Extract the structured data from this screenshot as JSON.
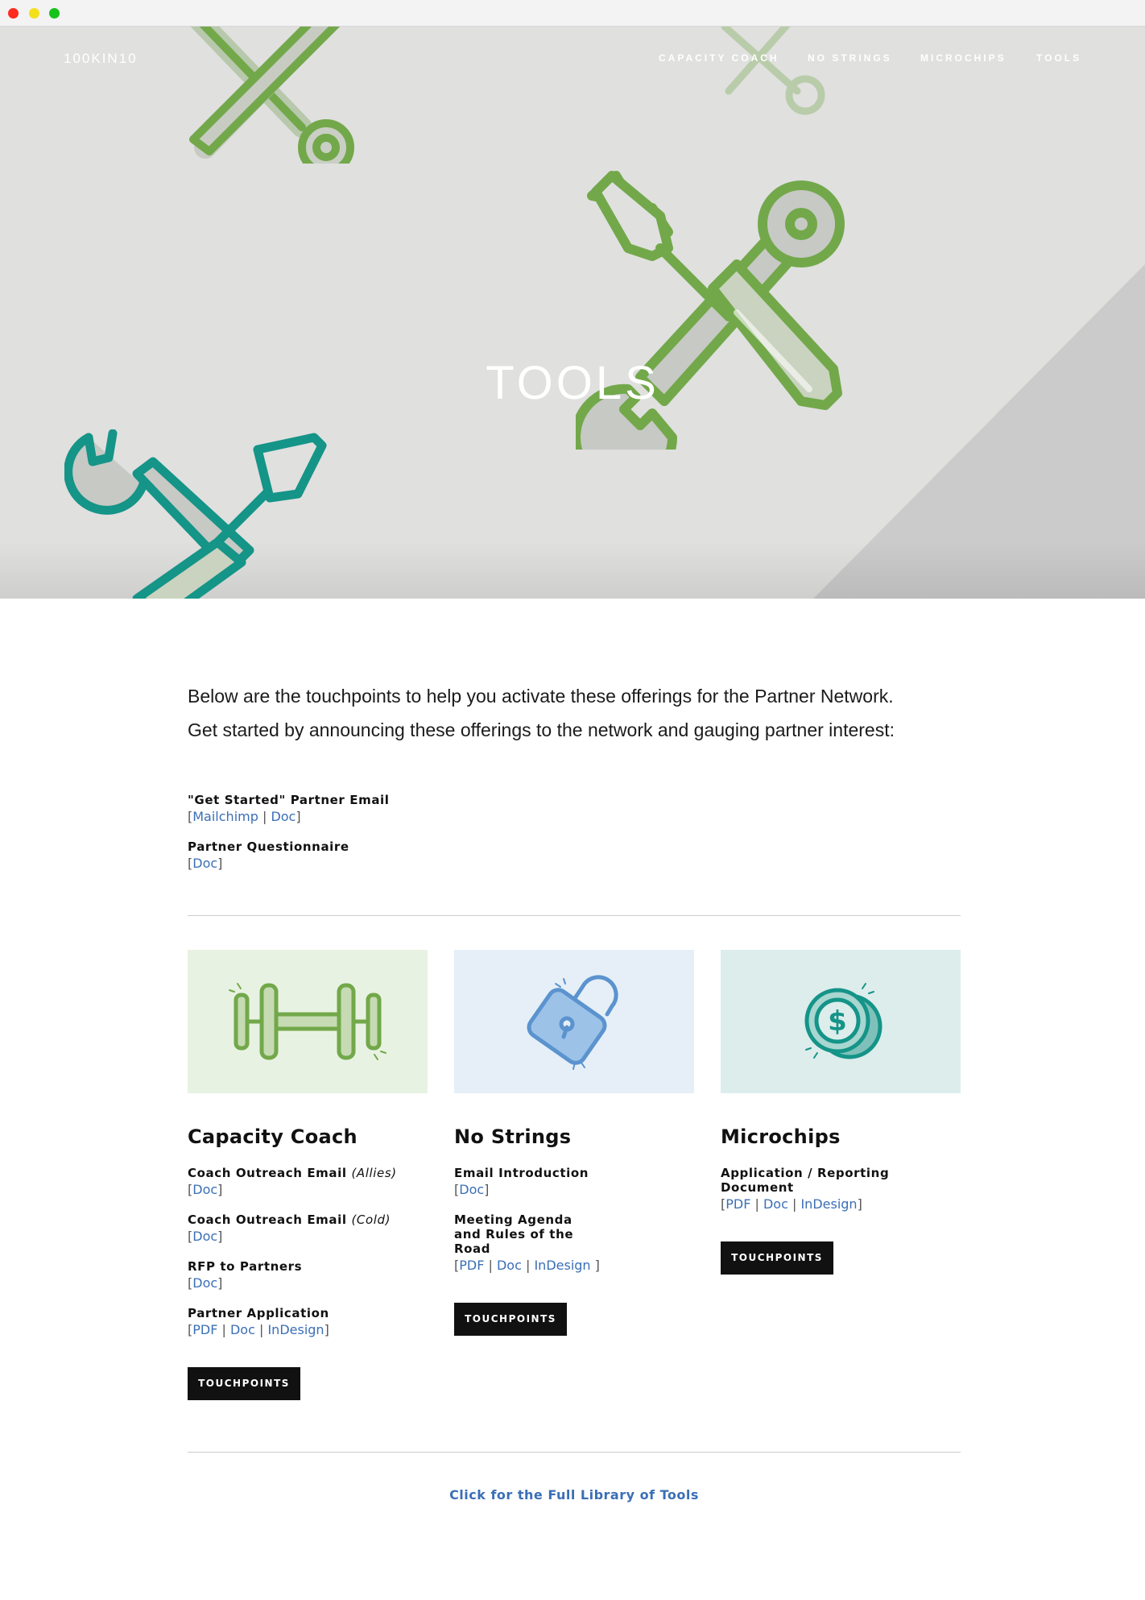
{
  "nav": {
    "brand": "100KIN10",
    "items": [
      "CAPACITY COACH",
      "NO STRINGS",
      "MICROCHIPS",
      "TOOLS"
    ]
  },
  "hero": {
    "title": "TOOLS"
  },
  "intro": {
    "text": "Below are the touchpoints to help you activate these offerings for the Partner Network. Get started by announcing these offerings to the network and gauging partner interest:",
    "items": [
      {
        "title": "\"Get Started\" Partner Email",
        "links": [
          "Mailchimp",
          "Doc"
        ]
      },
      {
        "title": "Partner Questionnaire",
        "links": [
          "Doc"
        ]
      }
    ]
  },
  "cards": [
    {
      "title": "Capacity Coach",
      "icon": "dumbbell-icon",
      "bg": "#e8f2e2",
      "items": [
        {
          "title": "Coach Outreach Email",
          "note": "(Allies)",
          "links": [
            "Doc"
          ]
        },
        {
          "title": "Coach Outreach Email",
          "note": "(Cold)",
          "links": [
            "Doc"
          ]
        },
        {
          "title": "RFP to Partners",
          "links": [
            "Doc"
          ]
        },
        {
          "title": "Partner Application",
          "links": [
            "PDF",
            "Doc",
            "InDesign"
          ]
        }
      ],
      "button": "TOUCHPOINTS"
    },
    {
      "title": "No Strings",
      "icon": "unlocked-padlock-icon",
      "bg": "#e6eff7",
      "items": [
        {
          "title": "Email Introduction",
          "links": [
            "Doc"
          ]
        },
        {
          "title": "Meeting Agenda and Rules of the Road",
          "links": [
            "PDF",
            "Doc",
            "InDesign"
          ]
        }
      ],
      "button": "TOUCHPOINTS"
    },
    {
      "title": "Microchips",
      "icon": "coins-icon",
      "bg": "#dcedec",
      "items": [
        {
          "title": "Application / Reporting Document",
          "links": [
            "PDF",
            "Doc",
            "InDesign"
          ]
        }
      ],
      "button": "TOUCHPOINTS"
    }
  ],
  "footer": {
    "full_library": "Click for the Full Library of Tools"
  },
  "colors": {
    "green": "#72a84a",
    "teal": "#159488",
    "link": "#3b6fb6",
    "hero_bg": "#e0e0df"
  }
}
